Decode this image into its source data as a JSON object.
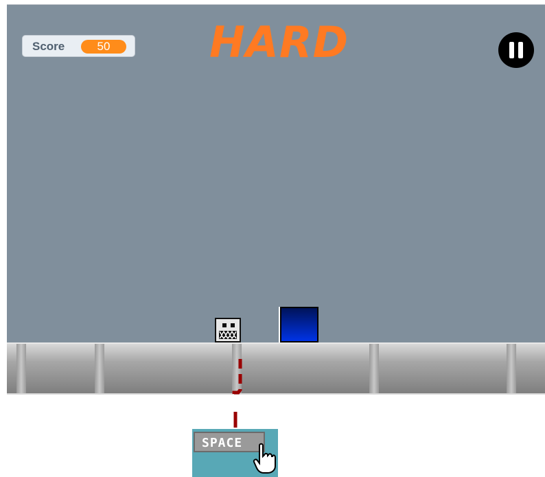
{
  "hud": {
    "score_label": "Score",
    "score_value": "50",
    "difficulty": "HARD",
    "pause_icon": "pause-icon"
  },
  "hint": {
    "key_label": "SPACE",
    "cursor_icon": "hand-pointer-icon"
  },
  "colors": {
    "sky": "#808f9c",
    "accent_orange": "#ff8c1a",
    "title_orange": "#ff7a22",
    "obstacle_blue": "#0033e6",
    "trace_red": "#990000"
  }
}
